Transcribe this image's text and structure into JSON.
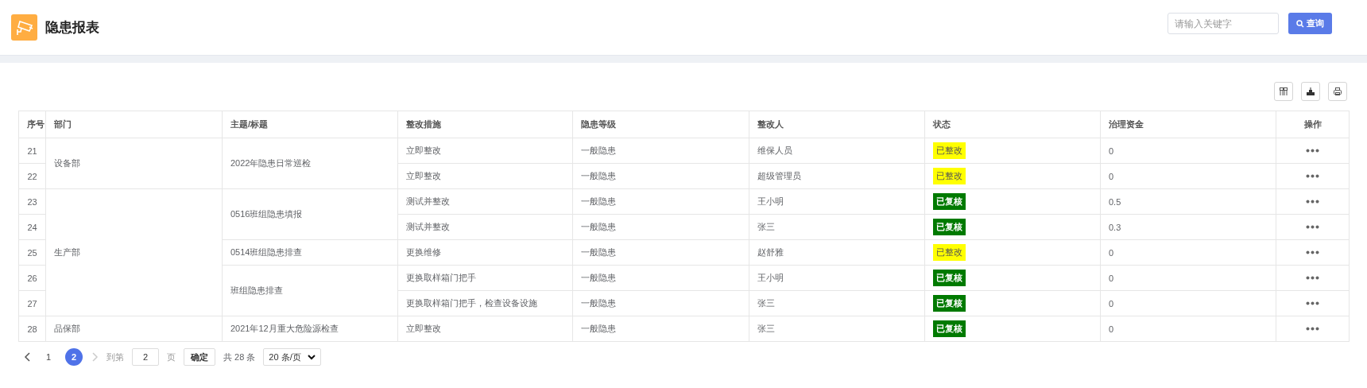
{
  "header": {
    "title": "隐患报表",
    "search": {
      "placeholder": "请输入关键字"
    },
    "search_button": "查询"
  },
  "table": {
    "columns": [
      "序号",
      "部门",
      "主题/标题",
      "整改措施",
      "隐患等级",
      "整改人",
      "状态",
      "治理资金",
      "操作"
    ],
    "groups": [
      {
        "department": "设备部",
        "topics": [
          {
            "title": "2022年隐患日常巡检",
            "rows": [
              {
                "index": "21",
                "measure": "立即整改",
                "level": "一般隐患",
                "assignee": "维保人员",
                "status": {
                  "label": "已整改",
                  "kind": "rectified"
                },
                "funds": "0"
              },
              {
                "index": "22",
                "measure": "立即整改",
                "level": "一般隐患",
                "assignee": "超级管理员",
                "status": {
                  "label": "已整改",
                  "kind": "rectified"
                },
                "funds": "0"
              }
            ]
          }
        ]
      },
      {
        "department": "生产部",
        "topics": [
          {
            "title": "0516班组隐患填报",
            "rows": [
              {
                "index": "23",
                "measure": "测试并整改",
                "level": "一般隐患",
                "assignee": "王小明",
                "status": {
                  "label": "已复核",
                  "kind": "reviewed"
                },
                "funds": "0.5"
              },
              {
                "index": "24",
                "measure": "测试并整改",
                "level": "一般隐患",
                "assignee": "张三",
                "status": {
                  "label": "已复核",
                  "kind": "reviewed"
                },
                "funds": "0.3"
              }
            ]
          },
          {
            "title": "0514班组隐患排查",
            "rows": [
              {
                "index": "25",
                "measure": "更换维修",
                "level": "一般隐患",
                "assignee": "赵舒雅",
                "status": {
                  "label": "已整改",
                  "kind": "rectified"
                },
                "funds": "0"
              }
            ]
          },
          {
            "title": "班组隐患排查",
            "rows": [
              {
                "index": "26",
                "measure": "更换取样箱门把手",
                "level": "一般隐患",
                "assignee": "王小明",
                "status": {
                  "label": "已复核",
                  "kind": "reviewed"
                },
                "funds": "0"
              },
              {
                "index": "27",
                "measure": "更换取样箱门把手，检查设备设施",
                "level": "一般隐患",
                "assignee": "张三",
                "status": {
                  "label": "已复核",
                  "kind": "reviewed"
                },
                "funds": "0"
              }
            ]
          }
        ]
      },
      {
        "department": "品保部",
        "topics": [
          {
            "title": "2021年12月重大危险源检查",
            "rows": [
              {
                "index": "28",
                "measure": "立即整改",
                "level": "一般隐患",
                "assignee": "张三",
                "status": {
                  "label": "已复核",
                  "kind": "reviewed"
                },
                "funds": "0"
              }
            ]
          }
        ]
      }
    ]
  },
  "pagination": {
    "prev_disabled": false,
    "next_disabled": true,
    "pages": [
      {
        "label": "1",
        "selected": false
      },
      {
        "label": "2",
        "selected": true
      }
    ],
    "goto_label": "到第",
    "goto_value": "2",
    "page_unit": "页",
    "confirm": "确定",
    "total": "共 28 条",
    "page_size": "20 条/页"
  }
}
